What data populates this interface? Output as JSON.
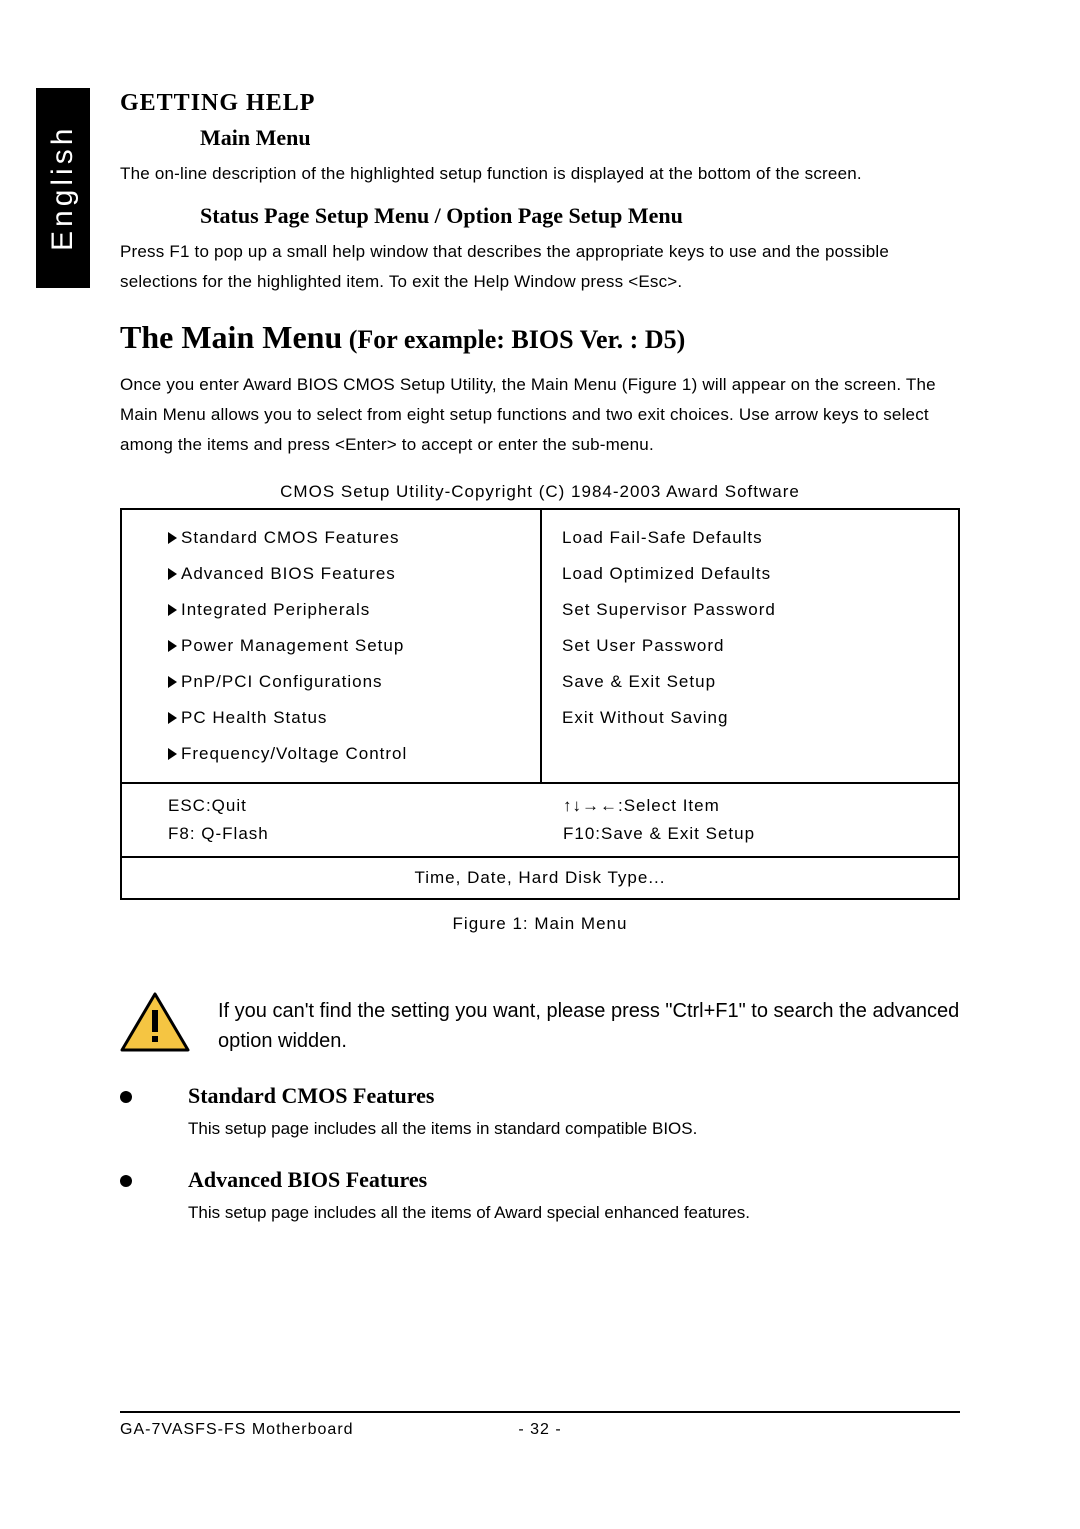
{
  "language_tab": "English",
  "getting_help": {
    "heading": "GETTING  HELP",
    "main_menu_heading": "Main Menu",
    "main_menu_text": "The on-line description of the highlighted setup function is displayed at the bottom of the screen.",
    "status_heading": "Status Page Setup Menu / Option Page Setup Menu",
    "status_text": "Press F1 to pop up a small help window that describes the appropriate keys to use and the possible selections for the highlighted item. To exit the Help Window press <Esc>."
  },
  "main_menu": {
    "title_main": "The Main Menu",
    "title_example": " (For example: BIOS Ver. : D5)",
    "intro": "Once you enter Award BIOS CMOS Setup Utility, the Main Menu (Figure 1) will appear on the screen. The Main Menu allows you to select from eight setup functions and two exit choices. Use arrow keys to select among the items and press <Enter> to accept or enter the sub-menu.",
    "top_caption": "CMOS Setup Utility-Copyright (C) 1984-2003 Award Software",
    "left_items": [
      "Standard CMOS Features",
      "Advanced BIOS Features",
      "Integrated Peripherals",
      "Power Management Setup",
      "PnP/PCI Configurations",
      "PC Health Status",
      "Frequency/Voltage Control"
    ],
    "right_items": [
      "Load Fail-Safe Defaults",
      "Load Optimized Defaults",
      "Set Supervisor Password",
      "Set User Password",
      "Save & Exit Setup",
      "Exit Without Saving"
    ],
    "keys": {
      "esc": "ESC:Quit",
      "arrows": "↑↓→←:Select Item",
      "f8": "F8: Q-Flash",
      "f10": "F10:Save & Exit Setup"
    },
    "hint": "Time, Date, Hard Disk Type...",
    "figure_caption": "Figure 1: Main Menu"
  },
  "warning": "If you can't find the setting you want, please press \"Ctrl+F1\" to search the advanced option widden.",
  "bullets": [
    {
      "title": "Standard CMOS Features",
      "desc": "This setup page includes all the items in standard compatible BIOS."
    },
    {
      "title": "Advanced BIOS Features",
      "desc": "This setup page includes all the items of Award special enhanced features."
    }
  ],
  "footer": {
    "left": "GA-7VASFS-FS Motherboard",
    "center": "- 32 -"
  }
}
